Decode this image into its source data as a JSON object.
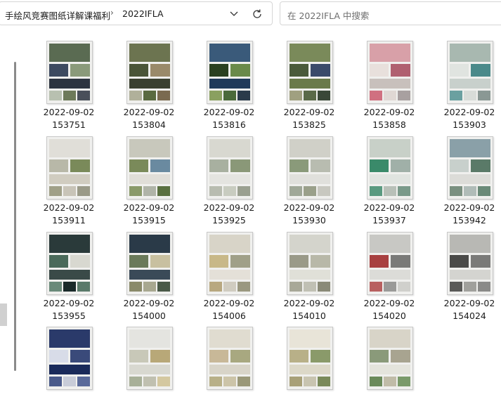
{
  "breadcrumb": {
    "parent": "手绘风竞赛图纸详解课福利",
    "separator": "›",
    "current": "2022IFLA"
  },
  "search": {
    "placeholder": "在 2022IFLA 中搜索"
  },
  "files": [
    {
      "date": "2022-09-02",
      "time": "153751",
      "palette": [
        "#5a6b52",
        "#3d4a60",
        "#8a9a7a",
        "#2c3440",
        "#b8c0b0",
        "#6d7a5a",
        "#494f5a"
      ]
    },
    {
      "date": "2022-09-02",
      "time": "153804",
      "palette": [
        "#6c7450",
        "#4a5538",
        "#9a8a6a",
        "#3a4030",
        "#b0b09a",
        "#5a6a40",
        "#7a6a50"
      ]
    },
    {
      "date": "2022-09-02",
      "time": "153816",
      "palette": [
        "#3a5a7a",
        "#2a4020",
        "#6a8a4a",
        "#203a5a",
        "#8aa060",
        "#4a6a3a",
        "#2a3a4a"
      ]
    },
    {
      "date": "2022-09-02",
      "time": "153825",
      "palette": [
        "#7a8a5a",
        "#4a5a3a",
        "#3a4a6a",
        "#6a7a4a",
        "#a0a080",
        "#5a6a48",
        "#3a4838"
      ]
    },
    {
      "date": "2022-09-02",
      "time": "153858",
      "palette": [
        "#d8a0a8",
        "#e8e0dc",
        "#b06070",
        "#c8c0bc",
        "#d07080",
        "#e0d8d4",
        "#a8a0a0"
      ]
    },
    {
      "date": "2022-09-02",
      "time": "153903",
      "palette": [
        "#a8b8b0",
        "#e0e4e0",
        "#4a8a8a",
        "#c8d0cc",
        "#6aa0a0",
        "#d8dcd8",
        "#8a9894"
      ]
    },
    {
      "date": "2022-09-02",
      "time": "153911",
      "palette": [
        "#e0ded8",
        "#b8b8a8",
        "#7a8a5a",
        "#d0ccc0",
        "#a0a088",
        "#c8c4b8",
        "#9a9a88"
      ]
    },
    {
      "date": "2022-09-02",
      "time": "153915",
      "palette": [
        "#c8c8bc",
        "#7a8a5a",
        "#6a8aa0",
        "#e0ded8",
        "#8a9a6a",
        "#b0b4a8",
        "#5a7040"
      ]
    },
    {
      "date": "2022-09-02",
      "time": "153925",
      "palette": [
        "#d8d8d0",
        "#a8b0a0",
        "#8a9878",
        "#e4e4e0",
        "#b8bcb0",
        "#c8ccc0",
        "#9aa090"
      ]
    },
    {
      "date": "2022-09-02",
      "time": "153930",
      "palette": [
        "#d0d0c8",
        "#8a9a7a",
        "#b8bcb0",
        "#e0e0dc",
        "#a0a898",
        "#9aa08a",
        "#c8c8c0"
      ]
    },
    {
      "date": "2022-09-02",
      "time": "153937",
      "palette": [
        "#c8d0c8",
        "#3a8a6a",
        "#a0b0a8",
        "#e0e4e0",
        "#5a9a80",
        "#b8c0b8",
        "#7a9a8a"
      ]
    },
    {
      "date": "2022-09-02",
      "time": "153942",
      "palette": [
        "#8aa0a8",
        "#c8d0cc",
        "#5a7a68",
        "#dcdcd8",
        "#7a9080",
        "#b0bcb8",
        "#6a8a78"
      ]
    },
    {
      "date": "2022-09-02",
      "time": "153955",
      "palette": [
        "#2a3a3a",
        "#4a6a5a",
        "#d8d8d0",
        "#3a4a48",
        "#6a8a7a",
        "#1a2a2a",
        "#5a7a6a"
      ]
    },
    {
      "date": "2022-09-02",
      "time": "154000",
      "palette": [
        "#2a3a48",
        "#6a7a5a",
        "#c8c0a0",
        "#3a4a58",
        "#8a8a6a",
        "#a8a890",
        "#4a5a48"
      ]
    },
    {
      "date": "2022-09-02",
      "time": "154006",
      "palette": [
        "#d8d4c8",
        "#c8b888",
        "#a0a088",
        "#e4e0d8",
        "#b8a880",
        "#d0ccc0",
        "#9a9880"
      ]
    },
    {
      "date": "2022-09-02",
      "time": "154010",
      "palette": [
        "#d4d4cc",
        "#9a9a88",
        "#b8b8a8",
        "#e0e0d8",
        "#a8a898",
        "#c0c0b4",
        "#8a8a78"
      ]
    },
    {
      "date": "2022-09-02",
      "time": "154020",
      "palette": [
        "#c8c8c4",
        "#a84040",
        "#7a7a78",
        "#dcdcd8",
        "#b86060",
        "#9a9a98",
        "#d0d0cc"
      ]
    },
    {
      "date": "2022-09-02",
      "time": "154024",
      "palette": [
        "#b8b8b4",
        "#4a4a48",
        "#7a7a78",
        "#d4d4d0",
        "#5a5a58",
        "#a0a09c",
        "#8a8a88"
      ]
    },
    {
      "date": "",
      "time": "",
      "palette": [
        "#2a3a6a",
        "#d8dce8",
        "#3a4a7a",
        "#1a2a5a",
        "#4a5a8a",
        "#c8ccd8",
        "#5a6a9a"
      ]
    },
    {
      "date": "",
      "time": "",
      "palette": [
        "#e4e4e0",
        "#c8c8b8",
        "#b8a878",
        "#d8d8d0",
        "#a8b098",
        "#c0c0b0",
        "#d4c8a0"
      ]
    },
    {
      "date": "",
      "time": "",
      "palette": [
        "#e0dcd0",
        "#c8b898",
        "#a8a880",
        "#d8d4c8",
        "#b8b088",
        "#ccc4a8",
        "#9a9878"
      ]
    },
    {
      "date": "",
      "time": "",
      "palette": [
        "#e8e4d8",
        "#b8b088",
        "#8a9a6a",
        "#dcd8c8",
        "#a8a078",
        "#c8c4b0",
        "#7a8a5a"
      ]
    },
    {
      "date": "",
      "time": "",
      "palette": [
        "#d8d4c8",
        "#8a9a7a",
        "#a8a490",
        "#e4e4dc",
        "#6a8a5a",
        "#c0bca8",
        "#7a9a6a"
      ]
    }
  ]
}
